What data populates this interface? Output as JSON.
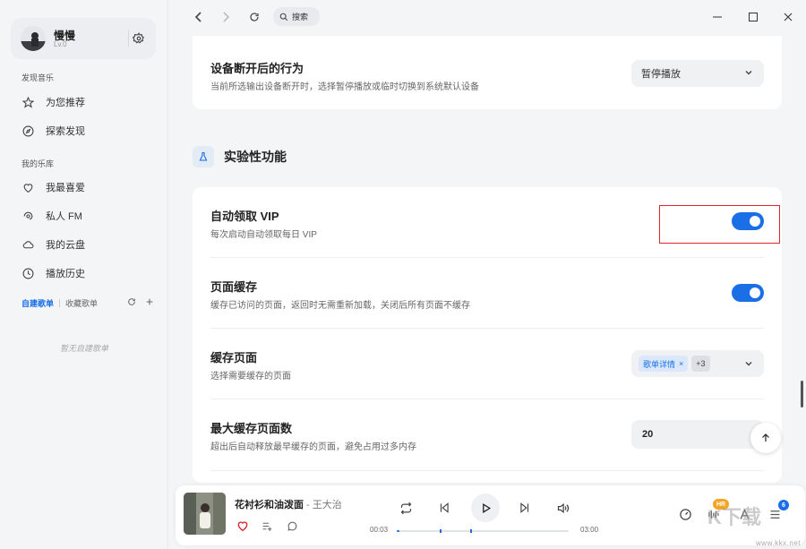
{
  "sidebar": {
    "user": {
      "name": "慢慢",
      "level": "Lv.0"
    },
    "discover_label": "发现音乐",
    "discover_items": [
      {
        "label": "为您推荐",
        "icon": "star-icon"
      },
      {
        "label": "探索发现",
        "icon": "compass-icon"
      }
    ],
    "library_label": "我的乐库",
    "library_items": [
      {
        "label": "我最喜爱",
        "icon": "heart-icon"
      },
      {
        "label": "私人 FM",
        "icon": "radio-icon"
      },
      {
        "label": "我的云盘",
        "icon": "cloud-icon"
      },
      {
        "label": "播放历史",
        "icon": "clock-icon"
      }
    ],
    "playlist_tabs": {
      "created": "自建歌单",
      "collected": "收藏歌单"
    },
    "empty_playlists": "暂无自建歌单"
  },
  "topbar": {
    "search_label": "搜索"
  },
  "settings": {
    "disconnect": {
      "title": "设备断开后的行为",
      "desc": "当前所选输出设备断开时，选择暂停播放或临时切换到系统默认设备",
      "value": "暂停播放"
    },
    "section_title": "实验性功能",
    "auto_vip": {
      "title": "自动领取 VIP",
      "desc": "每次启动自动领取每日 VIP",
      "enabled": true
    },
    "page_cache": {
      "title": "页面缓存",
      "desc": "缓存已访问的页面，返回时无需重新加载，关闭后所有页面不缓存",
      "enabled": true
    },
    "cache_pages": {
      "title": "缓存页面",
      "desc": "选择需要缓存的页面",
      "tag": "歌单详情",
      "tag_close": "×",
      "more": "+3"
    },
    "max_cache": {
      "title": "最大缓存页面数",
      "desc": "超出后自动释放最早缓存的页面，避免占用过多内存",
      "value": "20"
    }
  },
  "player": {
    "song": "花衬衫和油泼面",
    "separator": " - ",
    "artist": "王大治",
    "current_time": "00:03",
    "total_time": "03:00",
    "progress": 0.017,
    "quality_badge": "HR",
    "queue_count": "6"
  },
  "watermark": {
    "text": "www.kkx.net",
    "brand": "K下载"
  },
  "colors": {
    "accent": "#1a6fe6",
    "highlight_box": "#e0252b"
  }
}
